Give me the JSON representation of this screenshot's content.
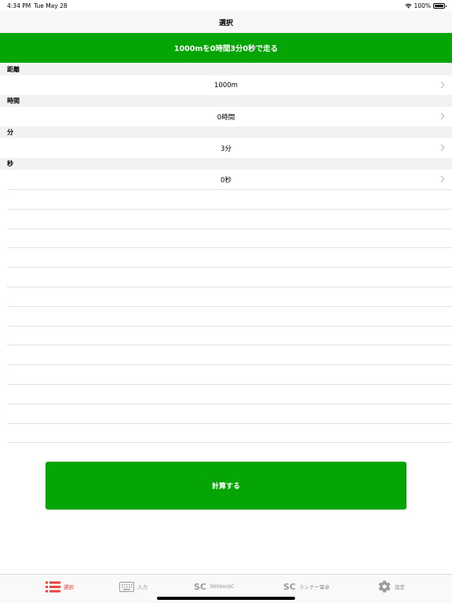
{
  "status_bar": {
    "time": "4:34 PM",
    "date": "Tue May 28",
    "battery": "100%"
  },
  "nav": {
    "title": "選択"
  },
  "result": {
    "text": "1000mを0時間3分0秒で走る"
  },
  "sections": [
    {
      "header": "距離",
      "value": "1000m"
    },
    {
      "header": "時間",
      "value": "0時間"
    },
    {
      "header": "分",
      "value": "3分"
    },
    {
      "header": "秒",
      "value": "0秒"
    }
  ],
  "calculate_button": {
    "label": "計算する"
  },
  "tabs": [
    {
      "label": "選択",
      "icon": "list-icon",
      "active": true
    },
    {
      "label": "入力",
      "icon": "keyboard-icon",
      "active": false
    },
    {
      "label": "3000mSC",
      "icon_text": "SC",
      "icon": "sc-icon",
      "active": false
    },
    {
      "label": "ランナー電卓",
      "icon_text": "SC",
      "icon": "sc-icon",
      "active": false
    },
    {
      "label": "設定",
      "icon": "gear-icon",
      "active": false
    }
  ],
  "colors": {
    "accent_green": "#06a506",
    "active_tab": "#e8453c",
    "inactive_tab": "#8e8e93"
  }
}
